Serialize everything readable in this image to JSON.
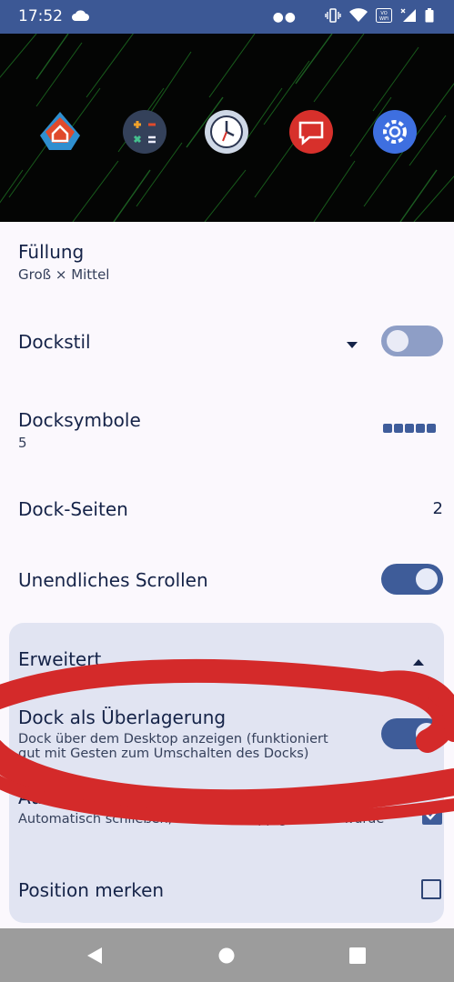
{
  "status": {
    "time": "17:52",
    "icons": [
      "cloud-icon",
      "dots-icon",
      "vibrate-icon",
      "wifi-icon",
      "vowifi-icon",
      "signal-icon",
      "battery-icon"
    ],
    "wifi_badge": "VO\nWiFi"
  },
  "dock_preview": {
    "icons": [
      "home-app-icon",
      "calculator-app-icon",
      "clock-app-icon",
      "messages-app-icon",
      "settings-app-icon"
    ]
  },
  "settings": {
    "fuellung": {
      "title": "Füllung",
      "subtitle": "Groß ⨯ Mittel"
    },
    "dockstil": {
      "title": "Dockstil",
      "toggle": false
    },
    "docksymbole": {
      "title": "Docksymbole",
      "value": "5"
    },
    "dockseiten": {
      "title": "Dock-Seiten",
      "value": "2"
    },
    "scroll": {
      "title": "Unendliches Scrollen",
      "toggle": true
    }
  },
  "erweitert": {
    "title": "Erweitert",
    "overlay": {
      "title": "Dock als Überlagerung",
      "subtitle": "Dock über dem Desktop anzeigen (funktioniert gut mit Gesten zum Umschalten des Docks)",
      "toggle": true
    },
    "autoclose": {
      "title": "Automatisch schließen",
      "subtitle": "Automatisch schließen, wenn eine App gestartet wurde",
      "checked": true
    },
    "position": {
      "title": "Position merken",
      "checked": false
    }
  },
  "colors": {
    "statusbar": "#3c5895",
    "accent": "#3e5c99",
    "background": "#fbf8fd",
    "card": "#e1e4f2",
    "annotation": "#d42a2a"
  }
}
